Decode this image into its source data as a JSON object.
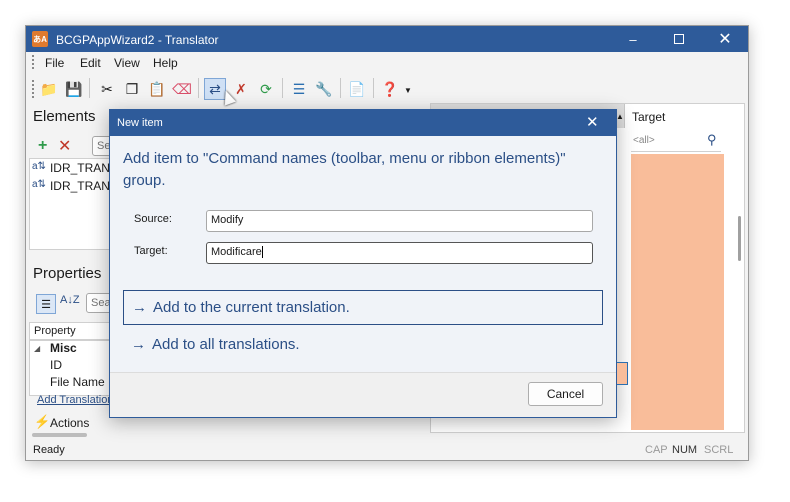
{
  "window": {
    "title": "BCGPAppWizard2 - Translator",
    "icon_label": "あA"
  },
  "menu": [
    "File",
    "Edit",
    "View",
    "Help"
  ],
  "elements_panel": {
    "title": "Elements",
    "search_placeholder": "Se",
    "items": [
      "IDR_TRANS",
      "IDR_TRANS"
    ]
  },
  "properties_panel": {
    "title": "Properties",
    "search_placeholder": "Sea",
    "column": "Property",
    "group": "Misc",
    "rows": [
      "ID",
      "File Name"
    ],
    "link": "Add Translation",
    "actions": "Actions"
  },
  "grid": {
    "target_header": "Target",
    "filter_placeholder": "<all>"
  },
  "status": {
    "text": "Ready",
    "cap": "CAP",
    "num": "NUM",
    "scrl": "SCRL"
  },
  "dialog": {
    "title": "New item",
    "heading": "Add item to \"Command names (toolbar, menu or ribbon elements)\" group.",
    "source_label": "Source:",
    "source_value": "Modify",
    "target_label": "Target:",
    "target_value": "Modificare",
    "option1": "Add to the current translation.",
    "option2": "Add to all translations.",
    "cancel": "Cancel"
  },
  "colors": {
    "accent": "#2e5b9a",
    "target_column": "#f9bd9a",
    "link": "#2b4f86"
  }
}
